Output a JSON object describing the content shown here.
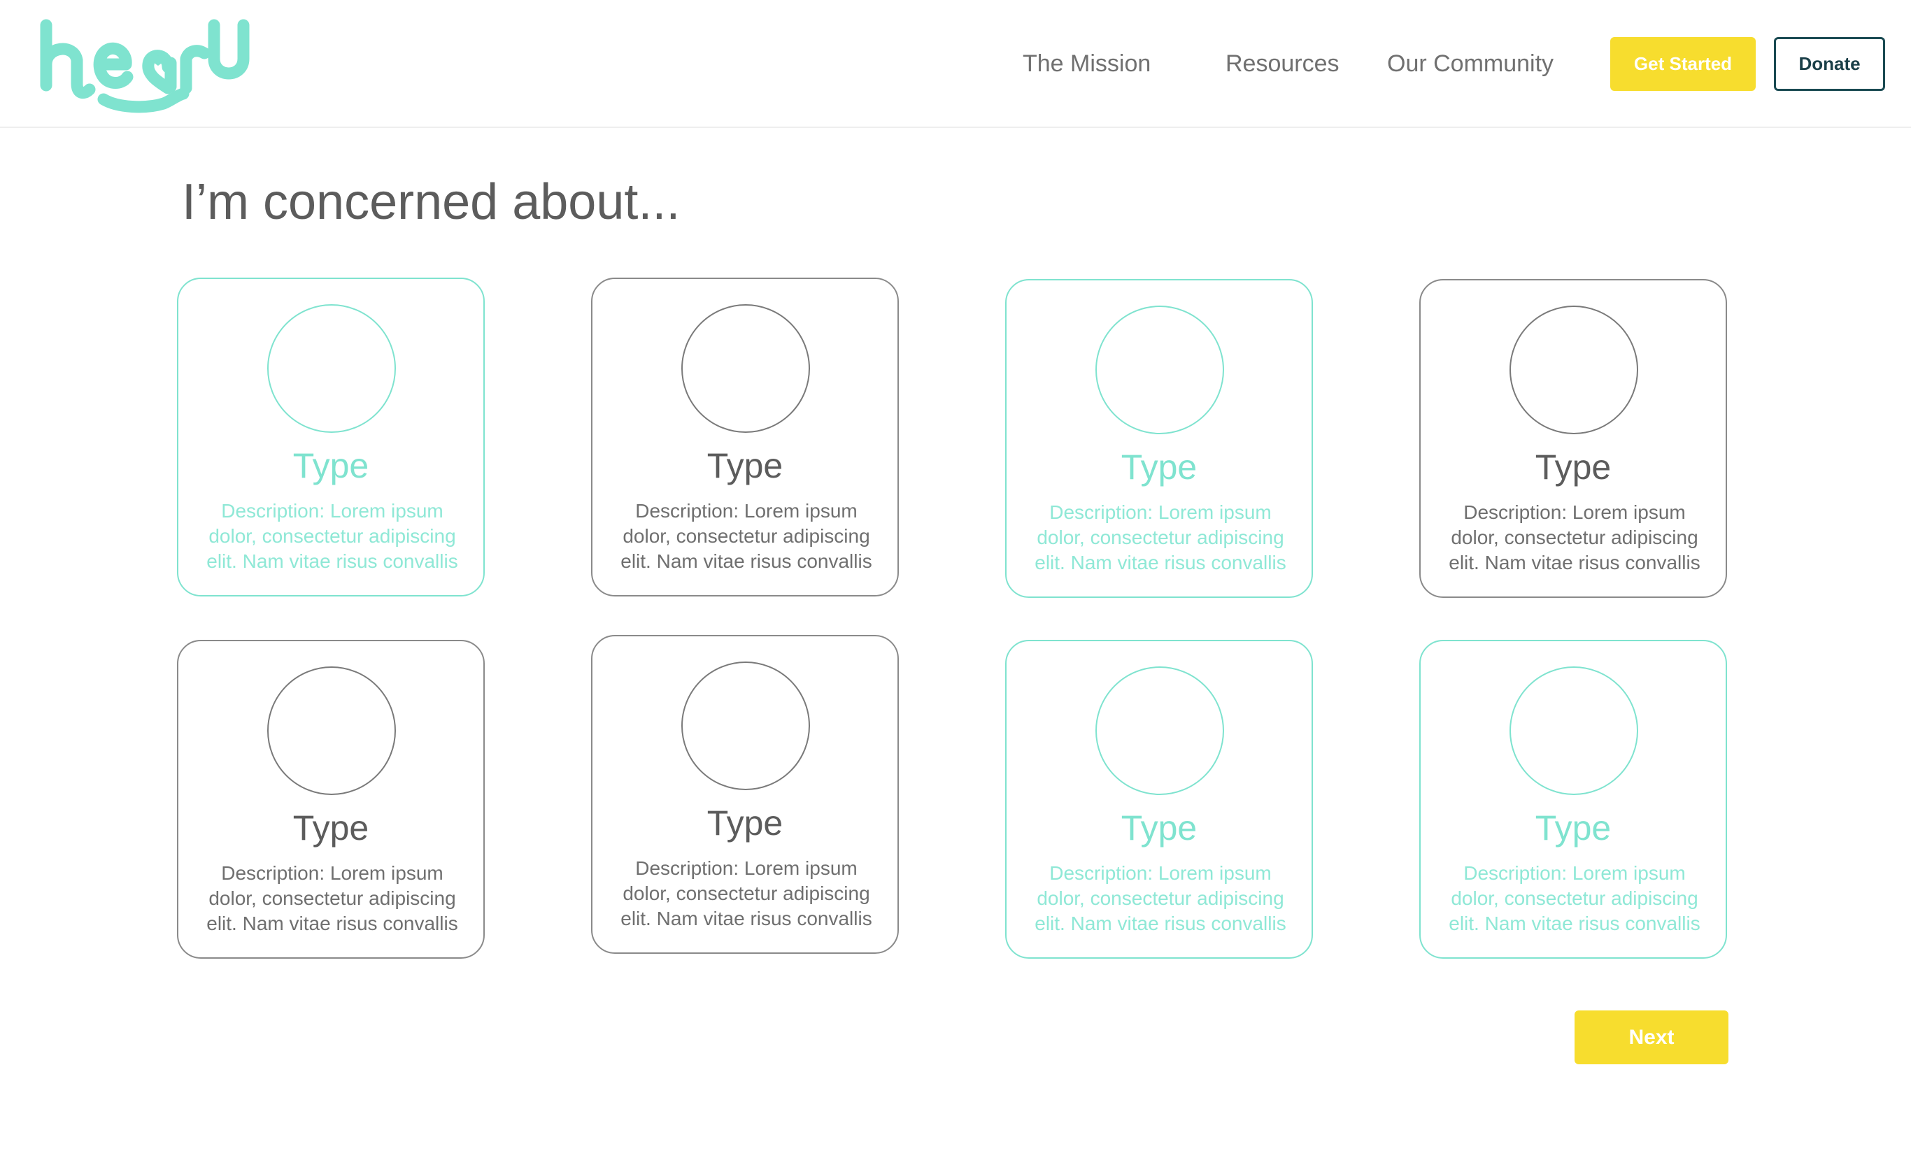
{
  "brand": {
    "logo_text": "hearU",
    "accent_color": "#7fe3cf",
    "button_color": "#f7dd2e",
    "donate_border_color": "#1a4a52"
  },
  "nav": {
    "items": [
      {
        "label": "The Mission"
      },
      {
        "label": "Resources"
      },
      {
        "label": "Our Community"
      }
    ],
    "get_started_label": "Get Started",
    "donate_label": "Donate"
  },
  "main": {
    "title": "I’m concerned about...",
    "cards": [
      {
        "type": "Type",
        "description": "Description: Lorem ipsum dolor, consectetur adipiscing elit. Nam vitae risus convallis",
        "state": "selected",
        "icon": "placeholder-circle"
      },
      {
        "type": "Type",
        "description": "Description: Lorem ipsum dolor, consectetur adipiscing elit. Nam vitae risus convallis",
        "state": "unselected",
        "icon": "placeholder-circle"
      },
      {
        "type": "Type",
        "description": "Description: Lorem ipsum dolor, consectetur adipiscing elit. Nam vitae risus convallis",
        "state": "selected",
        "icon": "placeholder-circle"
      },
      {
        "type": "Type",
        "description": "Description: Lorem ipsum dolor, consectetur adipiscing elit. Nam vitae risus convallis",
        "state": "unselected",
        "icon": "placeholder-circle"
      },
      {
        "type": "Type",
        "description": "Description: Lorem ipsum dolor, consectetur adipiscing elit. Nam vitae risus convallis",
        "state": "unselected",
        "icon": "placeholder-circle"
      },
      {
        "type": "Type",
        "description": "Description: Lorem ipsum dolor, consectetur adipiscing elit. Nam vitae risus convallis",
        "state": "unselected",
        "icon": "placeholder-circle"
      },
      {
        "type": "Type",
        "description": "Description: Lorem ipsum dolor, consectetur adipiscing elit. Nam vitae risus convallis",
        "state": "selected",
        "icon": "placeholder-circle"
      },
      {
        "type": "Type",
        "description": "Description: Lorem ipsum dolor, consectetur adipiscing elit. Nam vitae risus convallis",
        "state": "selected",
        "icon": "placeholder-circle"
      }
    ],
    "next_label": "Next"
  }
}
